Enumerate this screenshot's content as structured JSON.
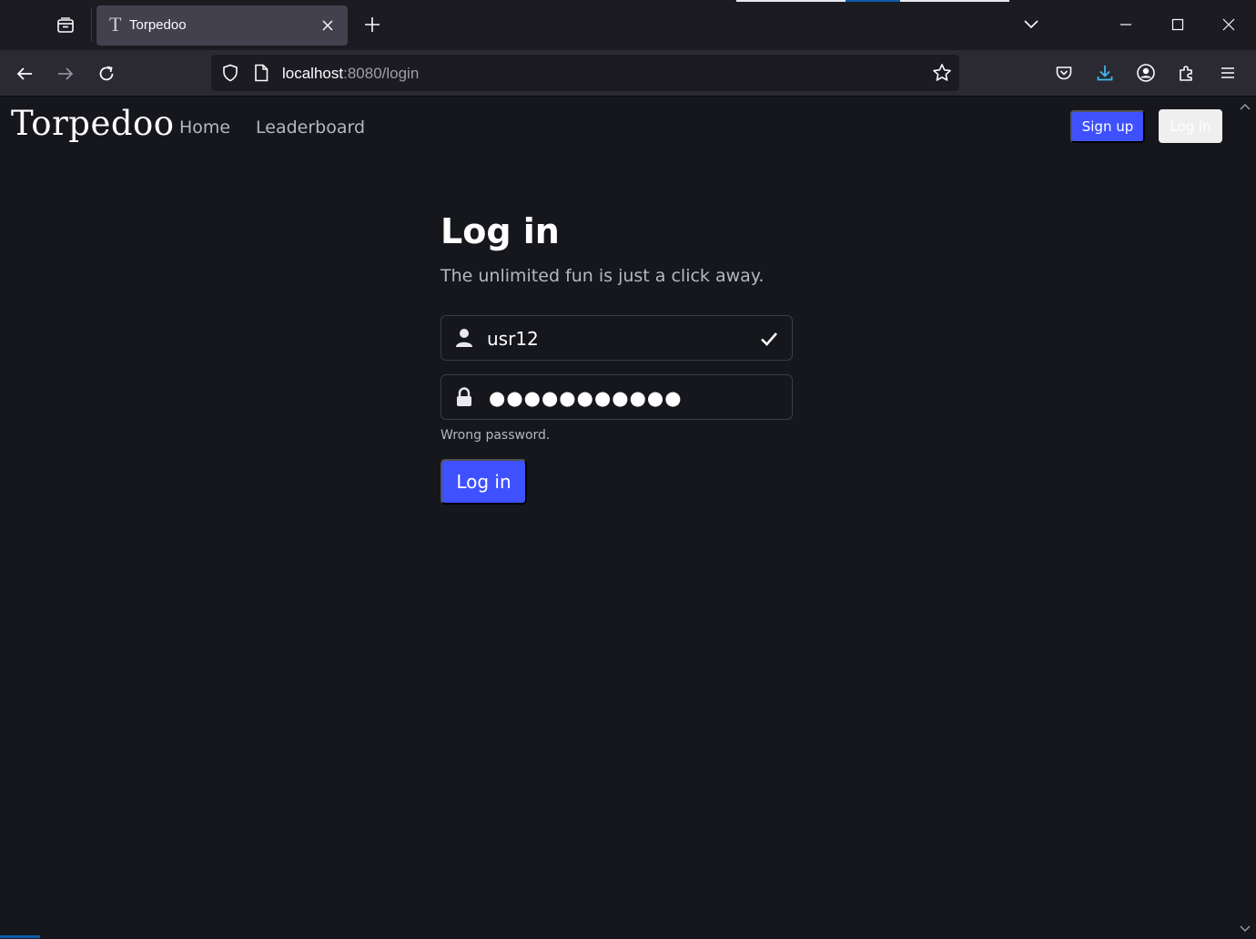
{
  "browser": {
    "tab_title": "Torpedoo",
    "tab_favicon": "T",
    "url_host": "localhost",
    "url_rest": ":8080/login"
  },
  "site": {
    "brand": "Torpedoo",
    "nav": {
      "home": "Home",
      "leaderboard": "Leaderboard"
    },
    "signup_label": "Sign up",
    "login_label": "Log in"
  },
  "login": {
    "title": "Log in",
    "subtitle": "The unlimited fun is just a click away.",
    "username_value": "usr12",
    "password_masked": "●●●●●●●●●●●",
    "error": "Wrong password.",
    "submit_label": "Log in"
  },
  "colors": {
    "accent": "#3f51ff",
    "page_bg": "#16171d",
    "chrome_bg": "#2b2a33"
  }
}
